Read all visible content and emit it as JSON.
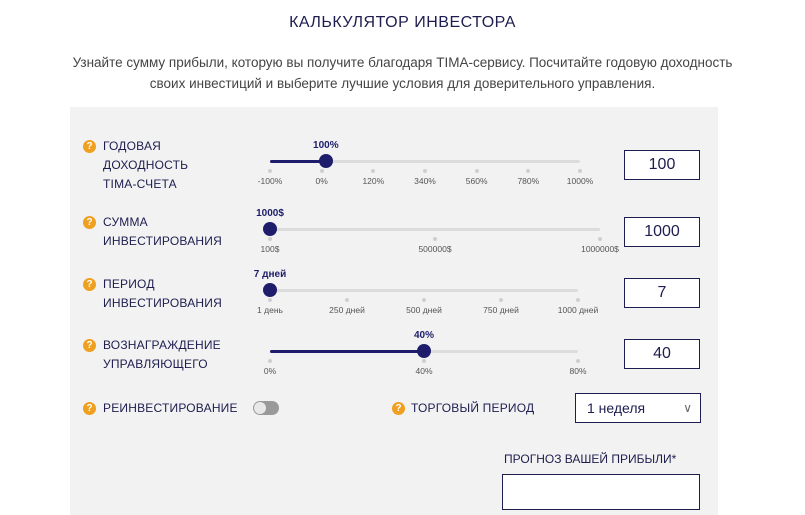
{
  "header": {
    "title": "КАЛЬКУЛЯТОР ИНВЕСТОРА",
    "subtitle_line1": "Узнайте сумму прибыли, которую вы получите благодаря TIMA-сервису. Посчитайте годовую доходность",
    "subtitle_line2": "своих инвестиций и выберите лучшие условия для доверительного управления."
  },
  "help_icon_glyph": "?",
  "accent_color": "#1d1d6b",
  "help_color": "#f0a020",
  "sliders": [
    {
      "id": "yield",
      "label_lines": [
        "ГОДОВАЯ",
        "ДОХОДНОСТЬ",
        "TIMA-СЧЕТА"
      ],
      "value_label": "100%",
      "fraction": 0.18,
      "ticks": [
        "-100%",
        "0%",
        "120%",
        "340%",
        "560%",
        "780%",
        "1000%"
      ],
      "input_value": "100"
    },
    {
      "id": "amount",
      "label_lines": [
        "СУММА",
        "ИНВЕСТИРОВАНИЯ"
      ],
      "value_label": "1000$",
      "fraction": 0.0,
      "ticks": [
        "100$",
        "500000$",
        "1000000$"
      ],
      "input_value": "1000"
    },
    {
      "id": "period",
      "label_lines": [
        "ПЕРИОД",
        "ИНВЕСТИРОВАНИЯ"
      ],
      "value_label": "7 дней",
      "fraction": 0.0,
      "ticks": [
        "1 день",
        "250 дней",
        "500 дней",
        "750 дней",
        "1000 дней"
      ],
      "input_value": "7"
    },
    {
      "id": "fee",
      "label_lines": [
        "ВОЗНАГРАЖДЕНИЕ",
        "УПРАВЛЯЮЩЕГО"
      ],
      "value_label": "40%",
      "fraction": 0.5,
      "ticks": [
        "0%",
        "40%",
        "80%"
      ],
      "input_value": "40"
    }
  ],
  "reinvest": {
    "label": "РЕИНВЕСТИРОВАНИЕ",
    "enabled": false
  },
  "trading_period": {
    "label": "ТОРГОВЫЙ ПЕРИОД",
    "selected": "1 неделя"
  },
  "forecast": {
    "label": "ПРОГНОЗ ВАШЕЙ ПРИБЫЛИ*",
    "value": ""
  }
}
